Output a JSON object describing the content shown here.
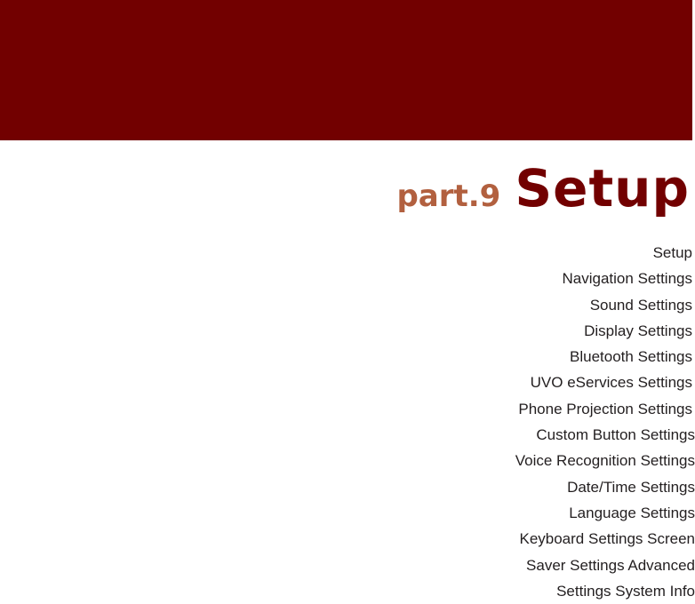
{
  "banner": {
    "color": "#720000"
  },
  "heading": {
    "part_label": "part.9",
    "title": "Setup",
    "part_color": "#b2603f",
    "title_color": "#720000"
  },
  "toc": {
    "items": [
      "Setup",
      "Navigation Settings",
      "Sound Settings",
      "Display Settings",
      "Bluetooth Settings",
      "UVO eServices Settings",
      "Phone Projection Settings",
      "Custom Button Settings",
      "Voice Recognition Settings",
      "Date/Time Settings",
      "Language Settings",
      "Keyboard Settings Screen",
      "Saver Settings Advanced",
      "Settings System Info"
    ]
  }
}
